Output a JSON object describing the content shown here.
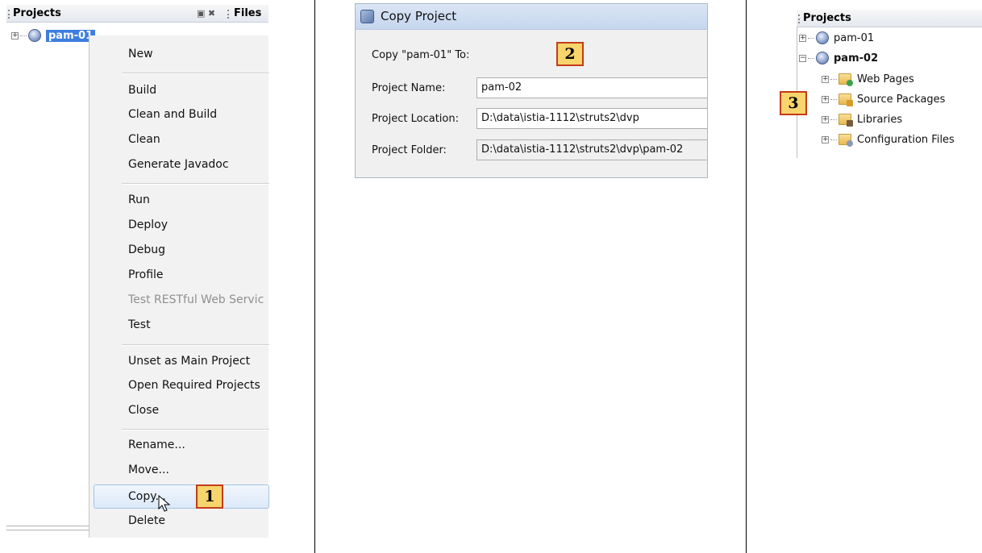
{
  "panel1": {
    "projects_tab": "Projects",
    "files_tab": "Files",
    "header_icons": "▣ ✖",
    "selected_project": "pam-01",
    "menu": {
      "new": "New",
      "build": "Build",
      "clean_build": "Clean and Build",
      "clean": "Clean",
      "javadoc": "Generate Javadoc",
      "run": "Run",
      "deploy": "Deploy",
      "debug": "Debug",
      "profile": "Profile",
      "test_restful": "Test RESTful Web Servic",
      "test": "Test",
      "unset_main": "Unset as Main Project",
      "open_required": "Open Required Projects",
      "close": "Close",
      "rename": "Rename...",
      "move": "Move...",
      "copy": "Copy...",
      "delete": "Delete"
    },
    "step_badge": "1"
  },
  "panel2": {
    "title": "Copy Project",
    "heading": "Copy \"pam-01\" To:",
    "step_badge": "2",
    "name_label": "Project Name:",
    "name_value": "pam-02",
    "location_label": "Project Location:",
    "location_value": "D:\\data\\istia-1112\\struts2\\dvp",
    "folder_label": "Project Folder:",
    "folder_value": "D:\\data\\istia-1112\\struts2\\dvp\\pam-02"
  },
  "panel3": {
    "projects_tab": "Projects",
    "step_badge": "3",
    "tree": {
      "project1": "pam-01",
      "project2": "pam-02",
      "web_pages": "Web Pages",
      "source_packages": "Source Packages",
      "libraries": "Libraries",
      "config_files": "Configuration Files"
    }
  },
  "colors": {
    "selection": "#3d7ede",
    "badge_fill": "#f7d46c",
    "badge_border": "#c33c1a",
    "menu_bg": "#f2f2f2"
  }
}
